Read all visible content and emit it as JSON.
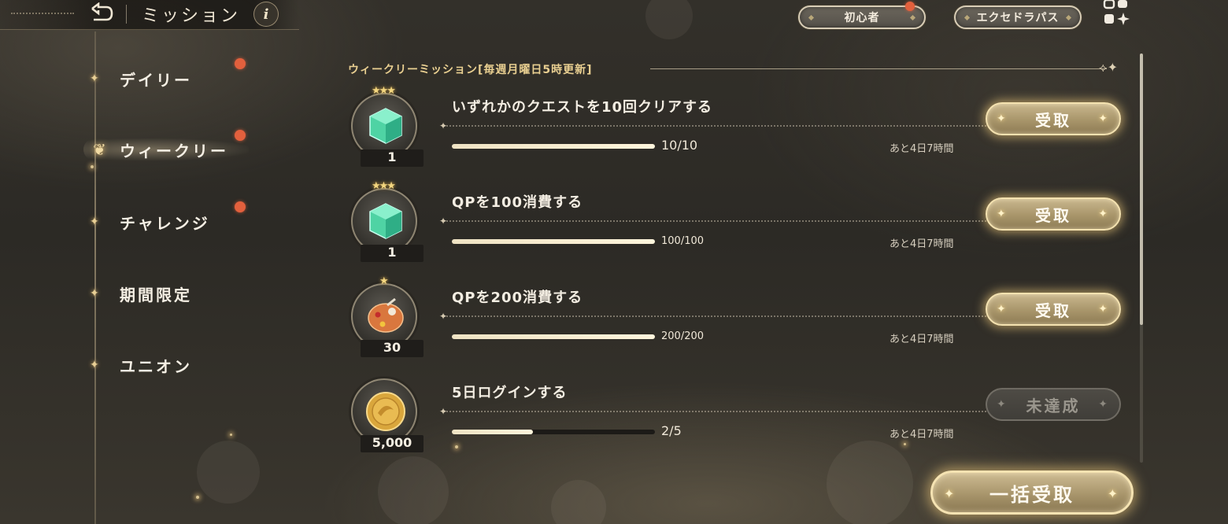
{
  "header": {
    "title": "ミッション",
    "info_label": "i"
  },
  "top_right": {
    "novice_label": "初心者",
    "pass_label": "エクセドラパス"
  },
  "sidebar": {
    "items": [
      {
        "label": "デイリー",
        "active": false,
        "has_notification": true
      },
      {
        "label": "ウィークリー",
        "active": true,
        "has_notification": true
      },
      {
        "label": "チャレンジ",
        "active": false,
        "has_notification": true
      },
      {
        "label": "期間限定",
        "active": false,
        "has_notification": false
      },
      {
        "label": "ユニオン",
        "active": false,
        "has_notification": false
      }
    ]
  },
  "section": {
    "title": "ウィークリーミッション[毎週月曜日5時更新]"
  },
  "missions": [
    {
      "title": "いずれかのクエストを10回クリアする",
      "progress": "10/10",
      "progress_fraction": 1.0,
      "remaining": "あと4日7時間",
      "reward_icon": "green-cube-icon",
      "reward_qty": "1",
      "reward_stars": "★★★",
      "button_label": "受取",
      "button_enabled": true
    },
    {
      "title": "QPを100消費する",
      "progress": "100/100",
      "progress_fraction": 1.0,
      "remaining": "あと4日7時間",
      "reward_icon": "green-cube-icon",
      "reward_qty": "1",
      "reward_stars": "★★★",
      "button_label": "受取",
      "button_enabled": true
    },
    {
      "title": "QPを200消費する",
      "progress": "200/200",
      "progress_fraction": 1.0,
      "remaining": "あと4日7時間",
      "reward_icon": "paint-palette-icon",
      "reward_qty": "30",
      "reward_stars": "★",
      "button_label": "受取",
      "button_enabled": true
    },
    {
      "title": "5日ログインする",
      "progress": "2/5",
      "progress_fraction": 0.4,
      "remaining": "あと4日7時間",
      "reward_icon": "gold-coin-icon",
      "reward_qty": "5,000",
      "reward_stars": "",
      "button_label": "未達成",
      "button_enabled": false
    }
  ],
  "bulk_claim_label": "一括受取",
  "colors": {
    "accent_gold": "#e9cf91",
    "notification": "#e2603d",
    "button_gold": "#a8956a"
  }
}
